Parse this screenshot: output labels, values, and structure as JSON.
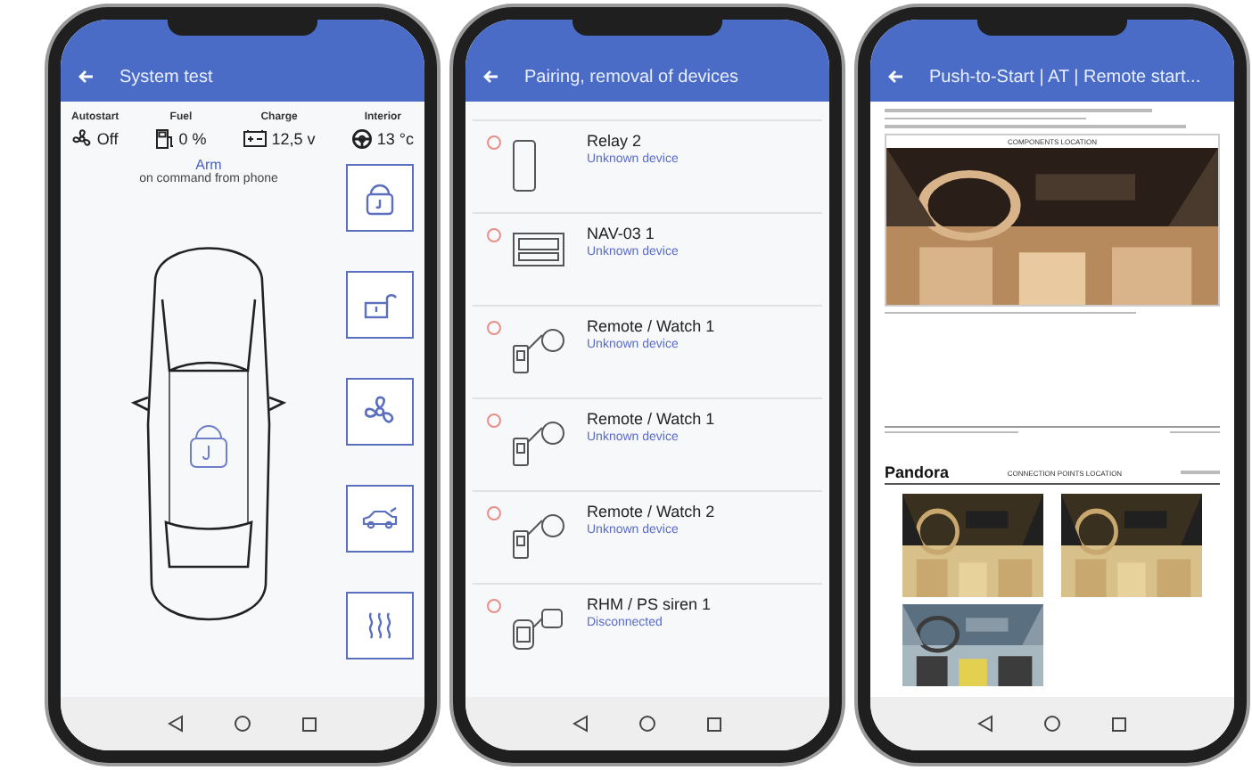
{
  "phones": [
    {
      "kind": "system",
      "title": "System test",
      "stats": [
        {
          "label": "Autostart",
          "value": "Off",
          "kind": "fan"
        },
        {
          "label": "Fuel",
          "value": "0 %",
          "kind": "fuel"
        },
        {
          "label": "Charge",
          "value": "12,5 v",
          "kind": "battery"
        },
        {
          "label": "Interior",
          "value": "13 °c",
          "kind": "seat"
        }
      ],
      "status": "Arm",
      "status_note": "on command from phone",
      "controls": [
        {
          "kind": "lock"
        },
        {
          "kind": "trunk"
        },
        {
          "kind": "fan"
        },
        {
          "kind": "car"
        },
        {
          "kind": "heat"
        }
      ]
    },
    {
      "kind": "devices",
      "title": "Pairing, removal of devices",
      "devices": [
        {
          "name": "Relay 2",
          "status": "Unknown device",
          "kind": "relay"
        },
        {
          "name": "NAV-03 1",
          "status": "Unknown device",
          "kind": "nav"
        },
        {
          "name": "Remote / Watch 1",
          "status": "Unknown device",
          "kind": "remote"
        },
        {
          "name": "Remote / Watch 1",
          "status": "Unknown device",
          "kind": "remote"
        },
        {
          "name": "Remote / Watch 2",
          "status": "Unknown device",
          "kind": "remote"
        },
        {
          "name": "RHM / PS siren 1",
          "status": "Disconnected",
          "kind": "siren"
        }
      ]
    },
    {
      "kind": "document",
      "title": "Push-to-Start | AT | Remote start...",
      "section_title": "COMPONENTS LOCATION",
      "brand": "Pandora",
      "page_heading": "CONNECTION POINTS LOCATION"
    }
  ]
}
